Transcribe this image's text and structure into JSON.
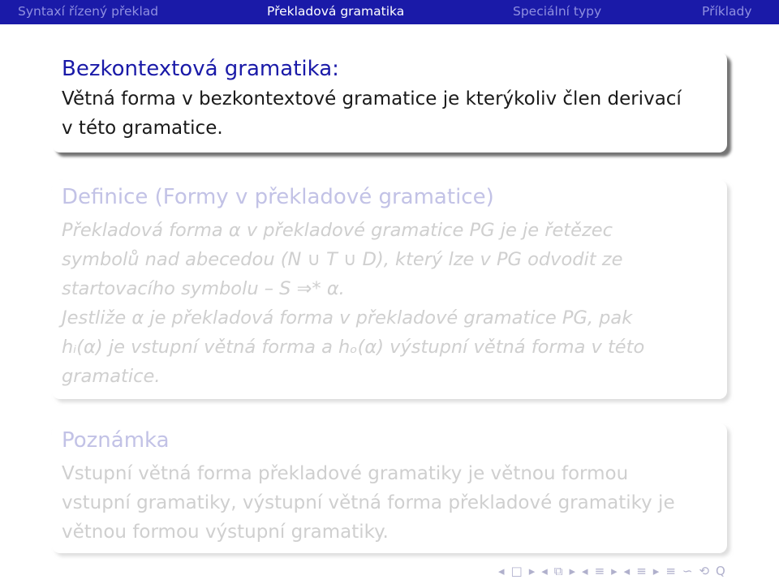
{
  "topnav": {
    "items": [
      {
        "label": "Syntaxí řízený překlad",
        "active": false
      },
      {
        "label": "Překladová gramatika",
        "active": true
      },
      {
        "label": "Speciální typy",
        "active": false
      },
      {
        "label": "Příklady",
        "active": false
      }
    ]
  },
  "block1": {
    "title": "Bezkontextová gramatika:",
    "line1": "Větná forma v bezkontextové gramatice je kterýkoliv člen derivací",
    "line2": "v této gramatice."
  },
  "block2": {
    "title": "Definice (Formy v překladové gramatice)",
    "line1": "Překladová forma α v překladové gramatice PG je je řetězec",
    "line2": "symbolů nad abecedou (N ∪ T ∪ D), který lze v PG odvodit ze",
    "line3": "startovacího symbolu – S ⇒* α.",
    "line4": "Jestliže α je překladová forma v překladové gramatice PG, pak",
    "line5": "hᵢ(α) je vstupní větná forma a hₒ(α) výstupní větná forma v této",
    "line6": "gramatice."
  },
  "block3": {
    "title": "Poznámka",
    "line1": "Vstupní větná forma překladové gramatiky je větnou formou",
    "line2": "vstupní gramatiky, výstupní větná forma překladové gramatiky je",
    "line3": "větnou formou výstupní gramatiky."
  },
  "colors": {
    "bar": "#1a1aa8",
    "accent": "#1a1aa8",
    "faded_title": "#c2c2e6",
    "faded_text": "#cfcfcf"
  },
  "navsymbols": [
    "◂",
    "□",
    "▸",
    "◂",
    "⧉",
    "▸",
    "◂",
    "≡",
    "▸",
    "◂",
    "≡",
    "▸",
    "≡",
    "∽",
    "⟲",
    "Q"
  ]
}
